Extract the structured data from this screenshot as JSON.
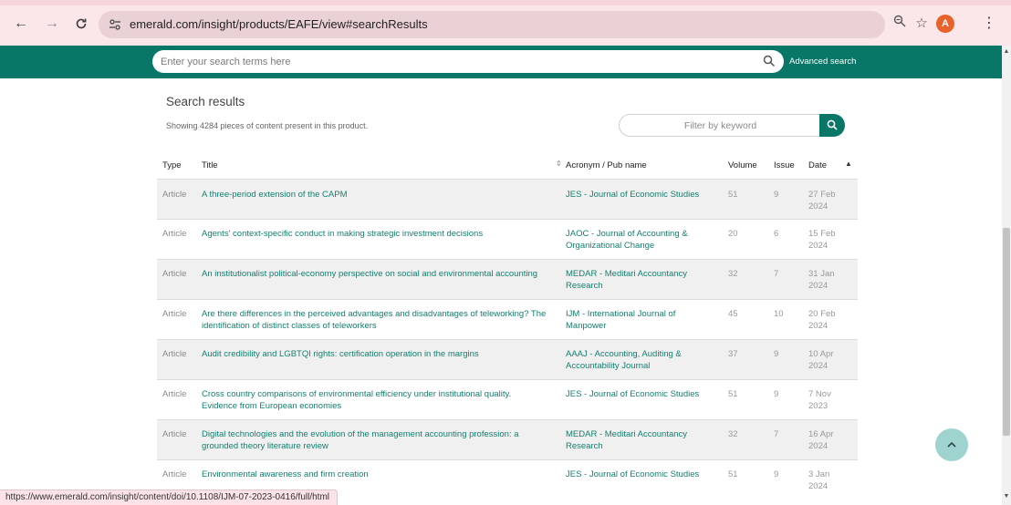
{
  "browser": {
    "url": "emerald.com/insight/products/EAFE/view#searchResults",
    "profile_initial": "A",
    "status_link": "https://www.emerald.com/insight/content/doi/10.1108/IJM-07-2023-0416/full/html"
  },
  "site": {
    "search_placeholder": "Enter your search terms here",
    "advanced_search_label": "Advanced search",
    "brand_color": "#097767"
  },
  "results": {
    "heading": "Search results",
    "showing_text": "Showing 4284 pieces of content present in this product.",
    "filter_placeholder": "Filter by keyword"
  },
  "table": {
    "headers": {
      "type": "Type",
      "title": "Title",
      "pub": "Acronym / Pub name",
      "volume": "Volume",
      "issue": "Issue",
      "date": "Date"
    },
    "rows": [
      {
        "type": "Article",
        "title": "A three-period extension of the CAPM",
        "pub": "JES - Journal of Economic Studies",
        "volume": "51",
        "issue": "9",
        "date": "27 Feb 2024"
      },
      {
        "type": "Article",
        "title": "Agents' context-specific conduct in making strategic investment decisions",
        "pub": "JAOC - Journal of Accounting & Organizational Change",
        "volume": "20",
        "issue": "6",
        "date": "15 Feb 2024"
      },
      {
        "type": "Article",
        "title": "An institutionalist political-economy perspective on social and environmental accounting",
        "pub": "MEDAR - Meditari Accountancy Research",
        "volume": "32",
        "issue": "7",
        "date": "31 Jan 2024"
      },
      {
        "type": "Article",
        "title": "Are there differences in the perceived advantages and disadvantages of teleworking? The identification of distinct classes of teleworkers",
        "pub": "IJM - International Journal of Manpower",
        "volume": "45",
        "issue": "10",
        "date": "20 Feb 2024"
      },
      {
        "type": "Article",
        "title": "Audit credibility and LGBTQI rights: certification operation in the margins",
        "pub": "AAAJ - Accounting, Auditing & Accountability Journal",
        "volume": "37",
        "issue": "9",
        "date": "10 Apr 2024"
      },
      {
        "type": "Article",
        "title": "Cross country comparisons of environmental efficiency under institutional quality. Evidence from European economies",
        "pub": "JES - Journal of Economic Studies",
        "volume": "51",
        "issue": "9",
        "date": "7 Nov 2023"
      },
      {
        "type": "Article",
        "title": "Digital technologies and the evolution of the management accounting profession: a grounded theory literature review",
        "pub": "MEDAR - Meditari Accountancy Research",
        "volume": "32",
        "issue": "7",
        "date": "16 Apr 2024"
      },
      {
        "type": "Article",
        "title": "Environmental awareness and firm creation",
        "pub": "JES - Journal of Economic Studies",
        "volume": "51",
        "issue": "9",
        "date": "3 Jan 2024"
      }
    ]
  }
}
